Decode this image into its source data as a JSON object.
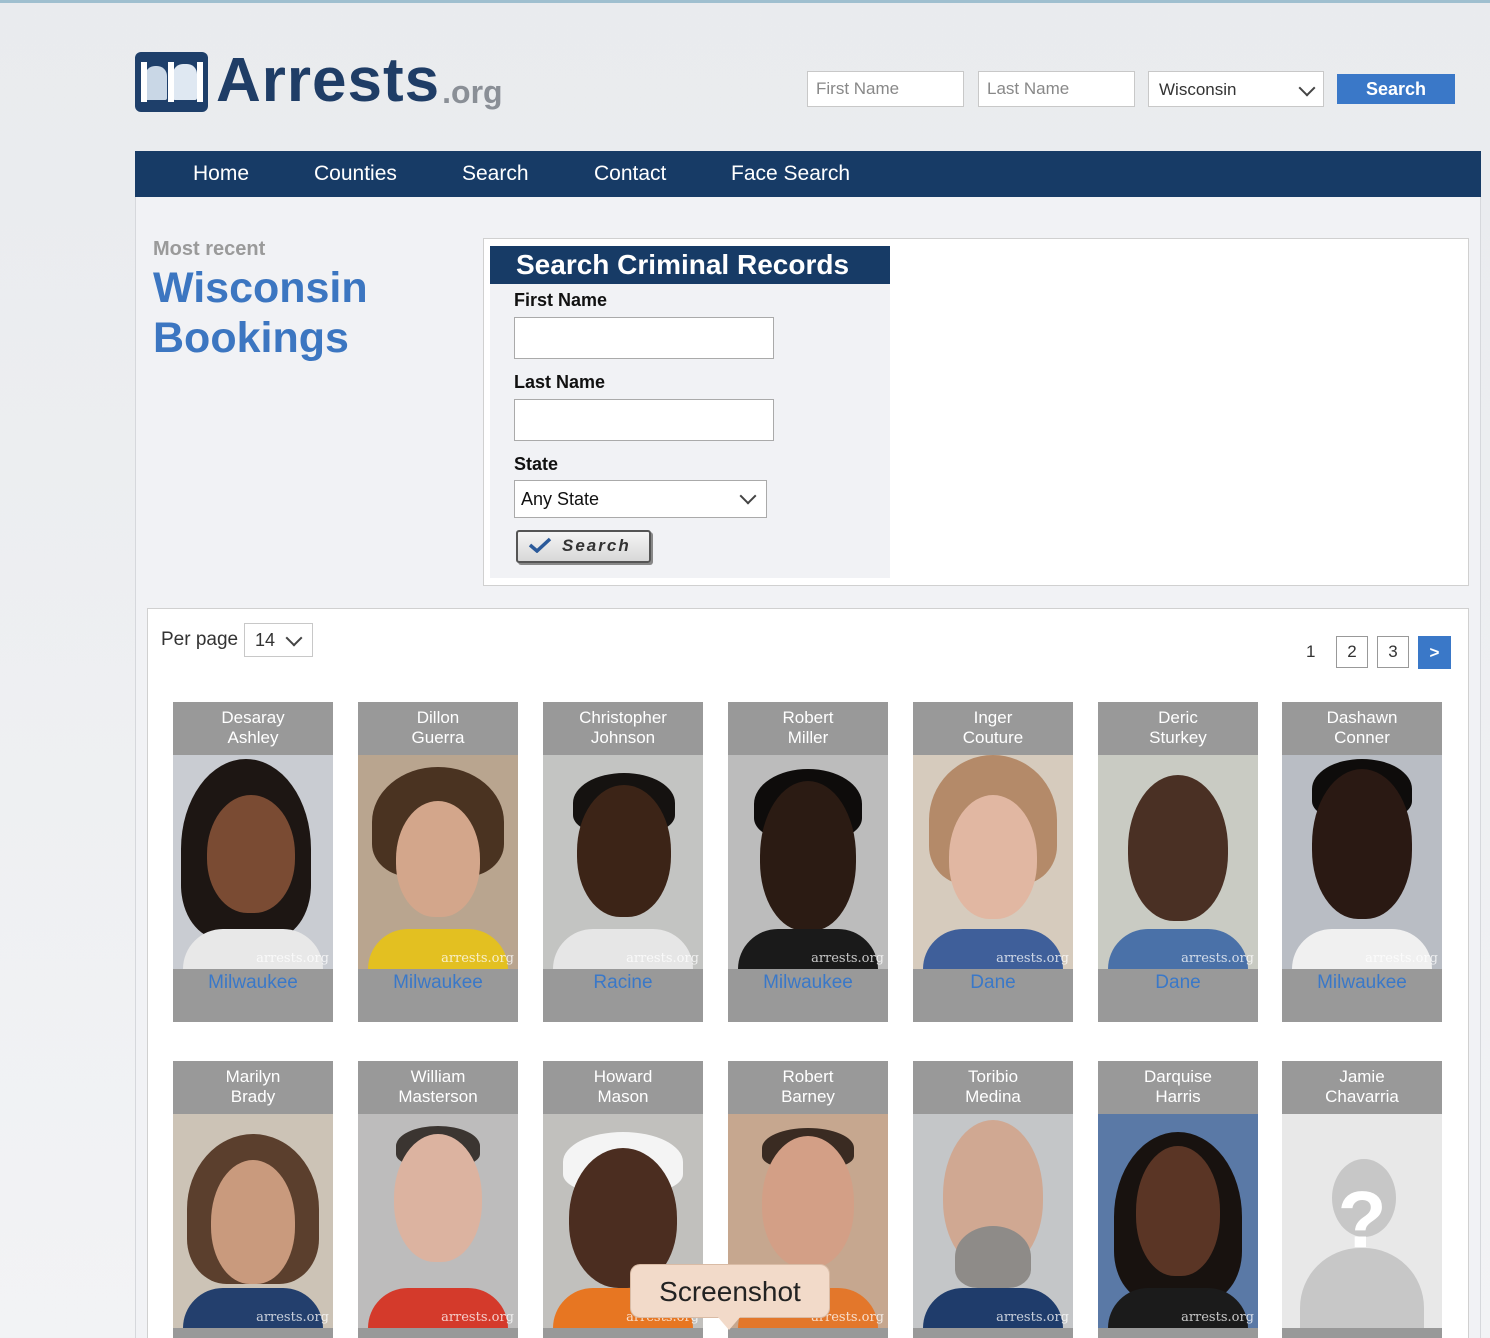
{
  "brand": {
    "name": "Arrests",
    "tld": ".org"
  },
  "header": {
    "first_name_placeholder": "First Name",
    "last_name_placeholder": "Last Name",
    "state_selected": "Wisconsin",
    "search_label": "Search"
  },
  "nav": [
    "Home",
    "Counties",
    "Search",
    "Contact",
    "Face Search"
  ],
  "intro": {
    "kicker": "Most recent",
    "title_line1": "Wisconsin",
    "title_line2": "Bookings"
  },
  "search_form": {
    "title": "Search Criminal Records",
    "first_name_label": "First Name",
    "last_name_label": "Last Name",
    "state_label": "State",
    "state_selected": "Any State",
    "button_label": "Search"
  },
  "results": {
    "per_page_label": "Per page",
    "per_page_value": "14",
    "pages": {
      "current": "1",
      "others": [
        "2",
        "3"
      ],
      "next": ">"
    },
    "bookings": [
      {
        "first": "Desaray",
        "last": "Ashley",
        "county": "Milwaukee"
      },
      {
        "first": "Dillon",
        "last": "Guerra",
        "county": "Milwaukee"
      },
      {
        "first": "Christopher",
        "last": "Johnson",
        "county": "Racine"
      },
      {
        "first": "Robert",
        "last": "Miller",
        "county": "Milwaukee"
      },
      {
        "first": "Inger",
        "last": "Couture",
        "county": "Dane"
      },
      {
        "first": "Deric",
        "last": "Sturkey",
        "county": "Dane"
      },
      {
        "first": "Dashawn",
        "last": "Conner",
        "county": "Milwaukee"
      },
      {
        "first": "Marilyn",
        "last": "Brady",
        "county": ""
      },
      {
        "first": "William",
        "last": "Masterson",
        "county": ""
      },
      {
        "first": "Howard",
        "last": "Mason",
        "county": ""
      },
      {
        "first": "Robert",
        "last": "Barney",
        "county": ""
      },
      {
        "first": "Toribio",
        "last": "Medina",
        "county": ""
      },
      {
        "first": "Darquise",
        "last": "Harris",
        "county": ""
      },
      {
        "first": "Jamie",
        "last": "Chavarria",
        "county": ""
      }
    ],
    "watermark": "arrests.org",
    "unknown_glyph": "?"
  },
  "tooltip": "Screenshot",
  "colors": {
    "nav": "#173b66",
    "accent": "#3a78c8",
    "title": "#3c76c1"
  },
  "icons": {
    "logo": "handcuffed-figures-logo",
    "dropdown": "chevron-down-icon",
    "check": "checkmark-icon",
    "placeholder": "unknown-person-icon"
  }
}
